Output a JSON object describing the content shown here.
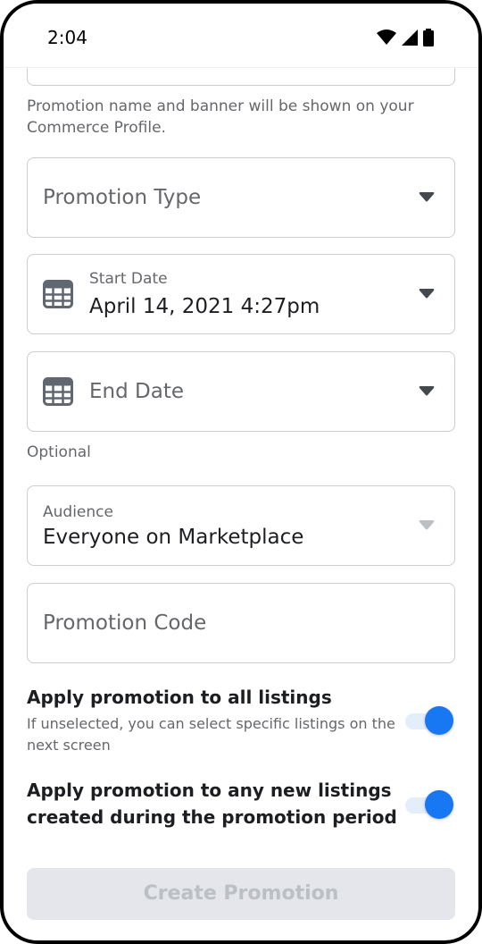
{
  "status_bar": {
    "time": "2:04",
    "icons": [
      "wifi-icon",
      "cellular-signal-icon",
      "battery-icon"
    ]
  },
  "form": {
    "name_helper": "Promotion name and banner will be shown on your Commerce Profile.",
    "promotion_type": {
      "placeholder": "Promotion Type"
    },
    "start_date": {
      "label": "Start Date",
      "value": "April 14, 2021 4:27pm"
    },
    "end_date": {
      "placeholder": "End Date",
      "helper": "Optional"
    },
    "audience": {
      "label": "Audience",
      "value": "Everyone on Marketplace"
    },
    "promotion_code": {
      "placeholder": "Promotion Code"
    },
    "apply_all": {
      "title": "Apply promotion to all listings",
      "subtitle": "If unselected, you can select specific listings on the next screen",
      "enabled": true
    },
    "apply_new": {
      "title_line1": "Apply promotion to any new listings",
      "title_line2": "created during the promotion period",
      "enabled": true
    },
    "create_button": "Create Promotion"
  },
  "colors": {
    "accent": "#1877f2",
    "toggle_track": "#e4eefb",
    "border": "#c9ccd1",
    "secondary_text": "#65676b",
    "disabled_button_bg": "#e4e6eb",
    "disabled_button_text": "#bcc0c4"
  }
}
